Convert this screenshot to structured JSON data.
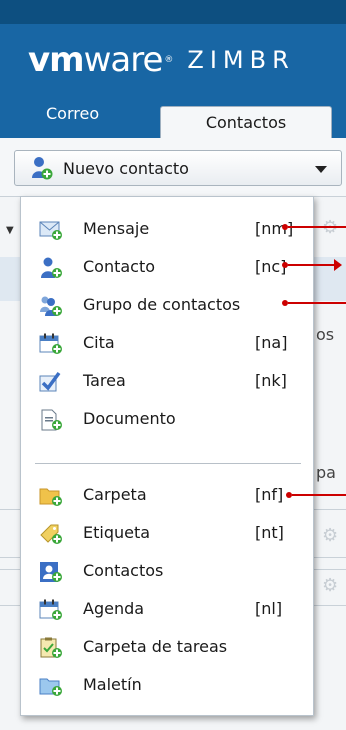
{
  "header": {
    "logo_vm": "vm",
    "logo_ware": "ware",
    "logo_reg": "®",
    "logo_product": "ZIMBR"
  },
  "tabs": {
    "mail": "Correo",
    "contacts": "Contactos"
  },
  "toolbar": {
    "new_button_label": "Nuevo contacto"
  },
  "background": {
    "fragment_1": "os",
    "fragment_2": "pa"
  },
  "menu": {
    "items": [
      {
        "label": "Mensaje",
        "shortcut": "[nm]",
        "icon": "envelope-icon"
      },
      {
        "label": "Contacto",
        "shortcut": "[nc]",
        "icon": "contact-icon"
      },
      {
        "label": "Grupo de contactos",
        "shortcut": "",
        "icon": "contact-group-icon"
      },
      {
        "label": "Cita",
        "shortcut": "[na]",
        "icon": "calendar-icon"
      },
      {
        "label": "Tarea",
        "shortcut": "[nk]",
        "icon": "task-icon"
      },
      {
        "label": "Documento",
        "shortcut": "",
        "icon": "document-icon"
      },
      {
        "label": "Carpeta",
        "shortcut": "[nf]",
        "icon": "folder-icon"
      },
      {
        "label": "Etiqueta",
        "shortcut": "[nt]",
        "icon": "tag-icon"
      },
      {
        "label": "Contactos",
        "shortcut": "",
        "icon": "address-book-icon"
      },
      {
        "label": "Agenda",
        "shortcut": "[nl]",
        "icon": "agenda-icon"
      },
      {
        "label": "Carpeta de tareas",
        "shortcut": "",
        "icon": "task-folder-icon"
      },
      {
        "label": "Maletín",
        "shortcut": "",
        "icon": "briefcase-icon"
      }
    ]
  },
  "colors": {
    "header": "#1866a4",
    "callout": "#cc0000",
    "plus_badge": "#3aa73a"
  }
}
